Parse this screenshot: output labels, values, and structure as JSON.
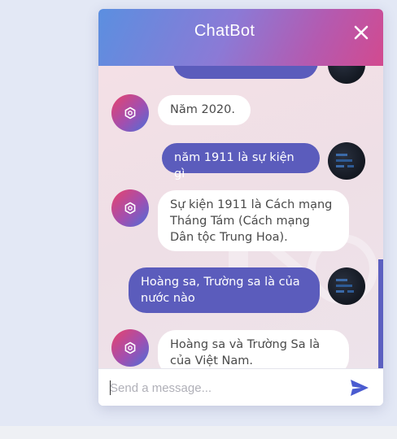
{
  "chat": {
    "title": "ChatBot",
    "close_icon": "close-icon",
    "send_icon": "send-icon",
    "input_placeholder": "Send a message...",
    "input_value": ""
  },
  "messages": [
    {
      "role": "bot",
      "text": "Năm 2020."
    },
    {
      "role": "user",
      "text": "năm 1911 là sự kiện gì"
    },
    {
      "role": "bot",
      "text": "Sự kiện 1911 là Cách mạng Tháng Tám (Cách mạng Dân tộc Trung Hoa)."
    },
    {
      "role": "user",
      "text": "Hoàng sa, Trường sa là của nước nào"
    },
    {
      "role": "bot",
      "text": "Hoàng sa và Trường Sa là của Việt Nam."
    }
  ],
  "colors": {
    "user_bubble": "#5b5cbc",
    "bot_bubble": "#ffffff",
    "header_gradient_start": "#5b8fe0",
    "header_gradient_end": "#d24a8f"
  }
}
